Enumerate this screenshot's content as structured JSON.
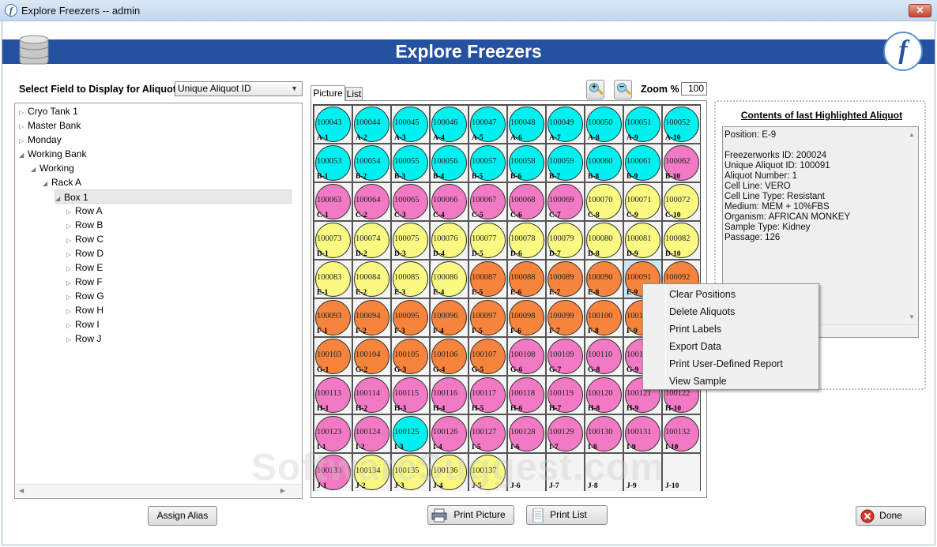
{
  "window": {
    "title": "Explore Freezers -- admin",
    "close_label": "✕"
  },
  "header": {
    "title": "Explore Freezers",
    "logo_text": "f"
  },
  "field_select": {
    "label": "Select Field to Display for Aliquots:",
    "value": "Unique Aliquot ID"
  },
  "tree": [
    {
      "label": "Cryo Tank 1",
      "level": 0,
      "expanded": false
    },
    {
      "label": "Master Bank",
      "level": 0,
      "expanded": false
    },
    {
      "label": "Monday",
      "level": 0,
      "expanded": false
    },
    {
      "label": "Working Bank",
      "level": 0,
      "expanded": true
    },
    {
      "label": "Working",
      "level": 1,
      "expanded": true
    },
    {
      "label": "Rack A",
      "level": 2,
      "expanded": true
    },
    {
      "label": "Box 1",
      "level": 3,
      "expanded": true,
      "selected": true
    },
    {
      "label": "Row A",
      "level": 4,
      "expanded": false
    },
    {
      "label": "Row B",
      "level": 4,
      "expanded": false
    },
    {
      "label": "Row C",
      "level": 4,
      "expanded": false
    },
    {
      "label": "Row D",
      "level": 4,
      "expanded": false
    },
    {
      "label": "Row E",
      "level": 4,
      "expanded": false
    },
    {
      "label": "Row F",
      "level": 4,
      "expanded": false
    },
    {
      "label": "Row G",
      "level": 4,
      "expanded": false
    },
    {
      "label": "Row H",
      "level": 4,
      "expanded": false
    },
    {
      "label": "Row I",
      "level": 4,
      "expanded": false
    },
    {
      "label": "Row J",
      "level": 4,
      "expanded": false
    }
  ],
  "tabs": {
    "picture": "Picture",
    "list": "List",
    "active": "picture"
  },
  "zoom": {
    "label": "Zoom %",
    "value": "100"
  },
  "colors": {
    "c": "#00f0f0",
    "p": "#f27ac4",
    "y": "#fafa82",
    "o": "#f7843c"
  },
  "grid": {
    "rows": [
      "A",
      "B",
      "C",
      "D",
      "E",
      "F",
      "G",
      "H",
      "I",
      "J"
    ],
    "first_id": 100043,
    "highlighted": "E-9",
    "row_colors": [
      "cccccccccc",
      "cccccccccp",
      "pppppppyyy",
      "yyyyyyyyyy",
      "yyyyoooooo",
      "oooooooooo",
      "ooooopppppp",
      "pppppppppp",
      "ppcppppppp",
      "pyyyy....."
    ]
  },
  "info": {
    "title": "Contents of last Highlighted Aliquot",
    "lines": [
      "Position: E-9",
      "",
      "Freezerworks ID: 200024",
      "Unique Aliquot ID: 100091",
      "Aliquot Number: 1",
      "Cell Line: VERO",
      "Cell Line Type: Resistant",
      "Medium: MEM + 10%FBS",
      "Organism: AFRICAN MONKEY",
      "Sample Type: Kidney",
      "Passage: 126"
    ]
  },
  "context_menu": [
    "Clear Positions",
    "Delete Aliquots",
    "Print Labels",
    "Export Data",
    "Print User-Defined Report",
    "View Sample"
  ],
  "buttons": {
    "assign_alias": "Assign Alias",
    "print_picture": "Print Picture",
    "print_list": "Print List",
    "done": "Done"
  },
  "watermark": "SoftwareSuggest.com"
}
